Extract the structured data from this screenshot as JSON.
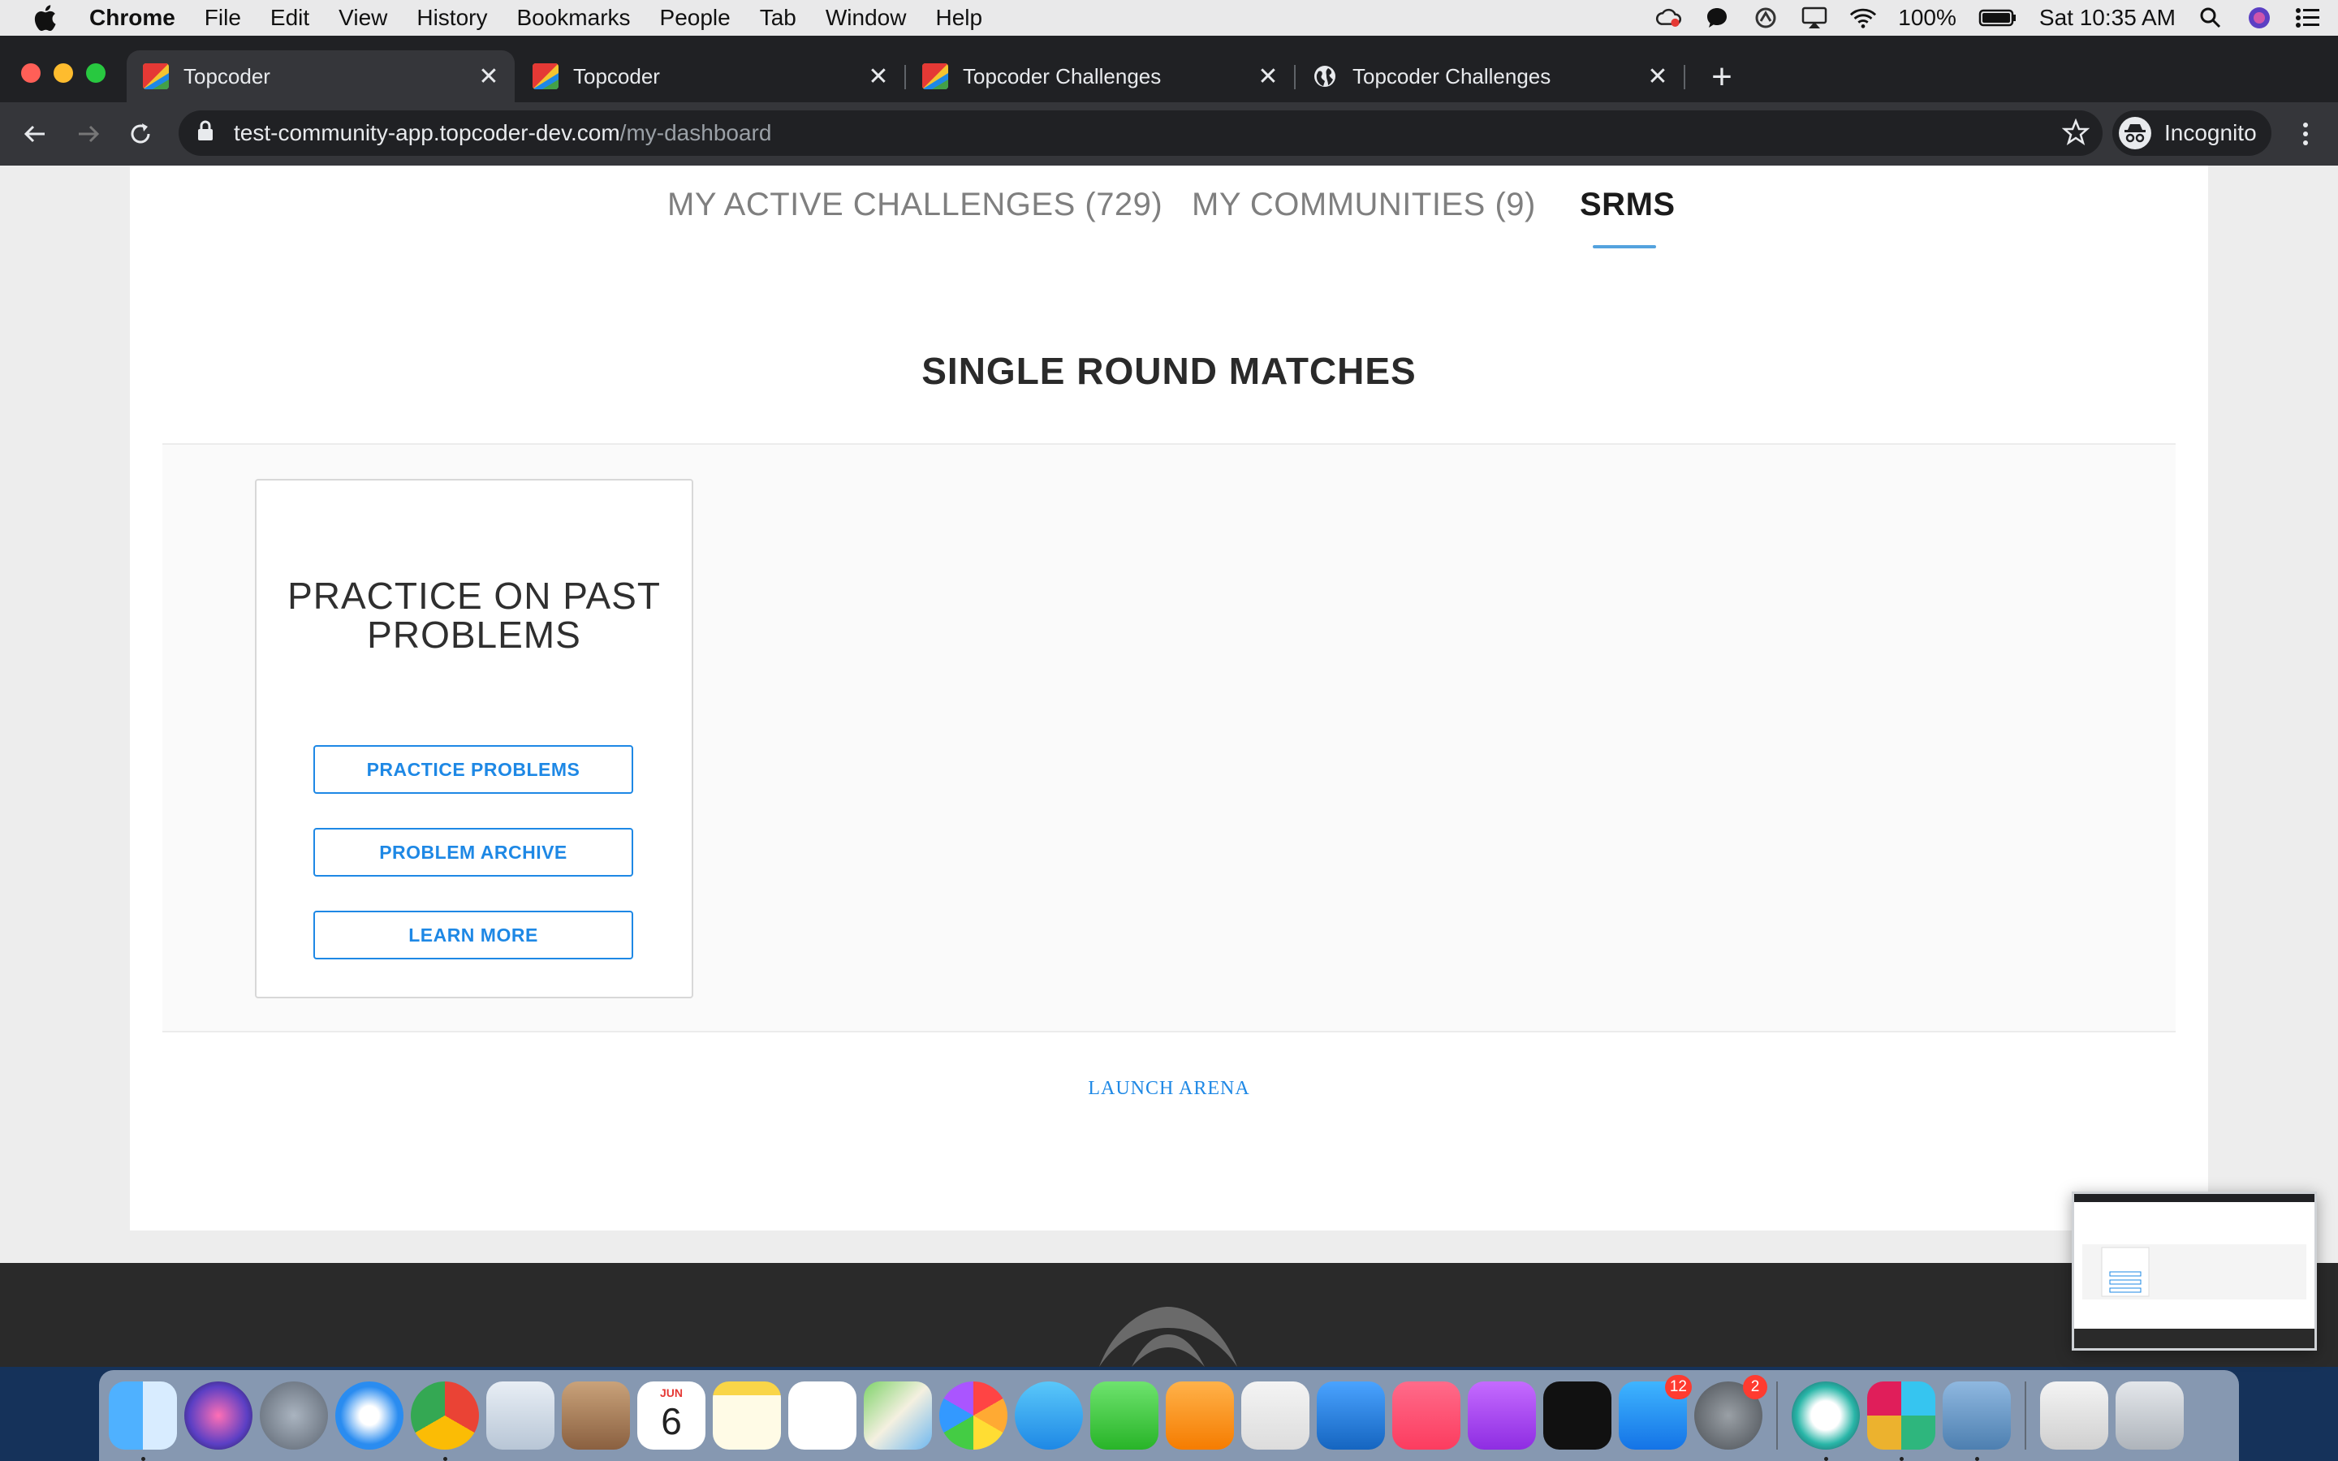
{
  "menubar": {
    "app_name": "Chrome",
    "items": [
      "File",
      "Edit",
      "View",
      "History",
      "Bookmarks",
      "People",
      "Tab",
      "Window",
      "Help"
    ],
    "battery": "100%",
    "clock": "Sat 10:35 AM"
  },
  "browser": {
    "tabs": [
      {
        "title": "Topcoder",
        "active": true
      },
      {
        "title": "Topcoder",
        "active": false
      },
      {
        "title": "Topcoder Challenges",
        "active": false
      },
      {
        "title": "Topcoder Challenges",
        "active": false
      }
    ],
    "url_host": "test-community-app.topcoder-dev.com",
    "url_path": "/my-dashboard",
    "profile_label": "Incognito"
  },
  "dashboard": {
    "tabs": [
      {
        "label": "MY ACTIVE CHALLENGES (729)",
        "active": false
      },
      {
        "label": "MY COMMUNITIES (9)",
        "active": false
      },
      {
        "label": "SRMS",
        "active": true
      }
    ],
    "section_title": "SINGLE ROUND MATCHES",
    "practice_card": {
      "title_line1": "PRACTICE ON PAST",
      "title_line2": "PROBLEMS",
      "buttons": [
        "PRACTICE PROBLEMS",
        "PROBLEM ARCHIVE",
        "LEARN MORE"
      ]
    },
    "launch_link": "LAUNCH ARENA",
    "accent_color": "#1e88e5"
  },
  "dock": {
    "calendar_month": "JUN",
    "calendar_day": "6",
    "appstore_badge": "12",
    "settings_badge": "2"
  }
}
